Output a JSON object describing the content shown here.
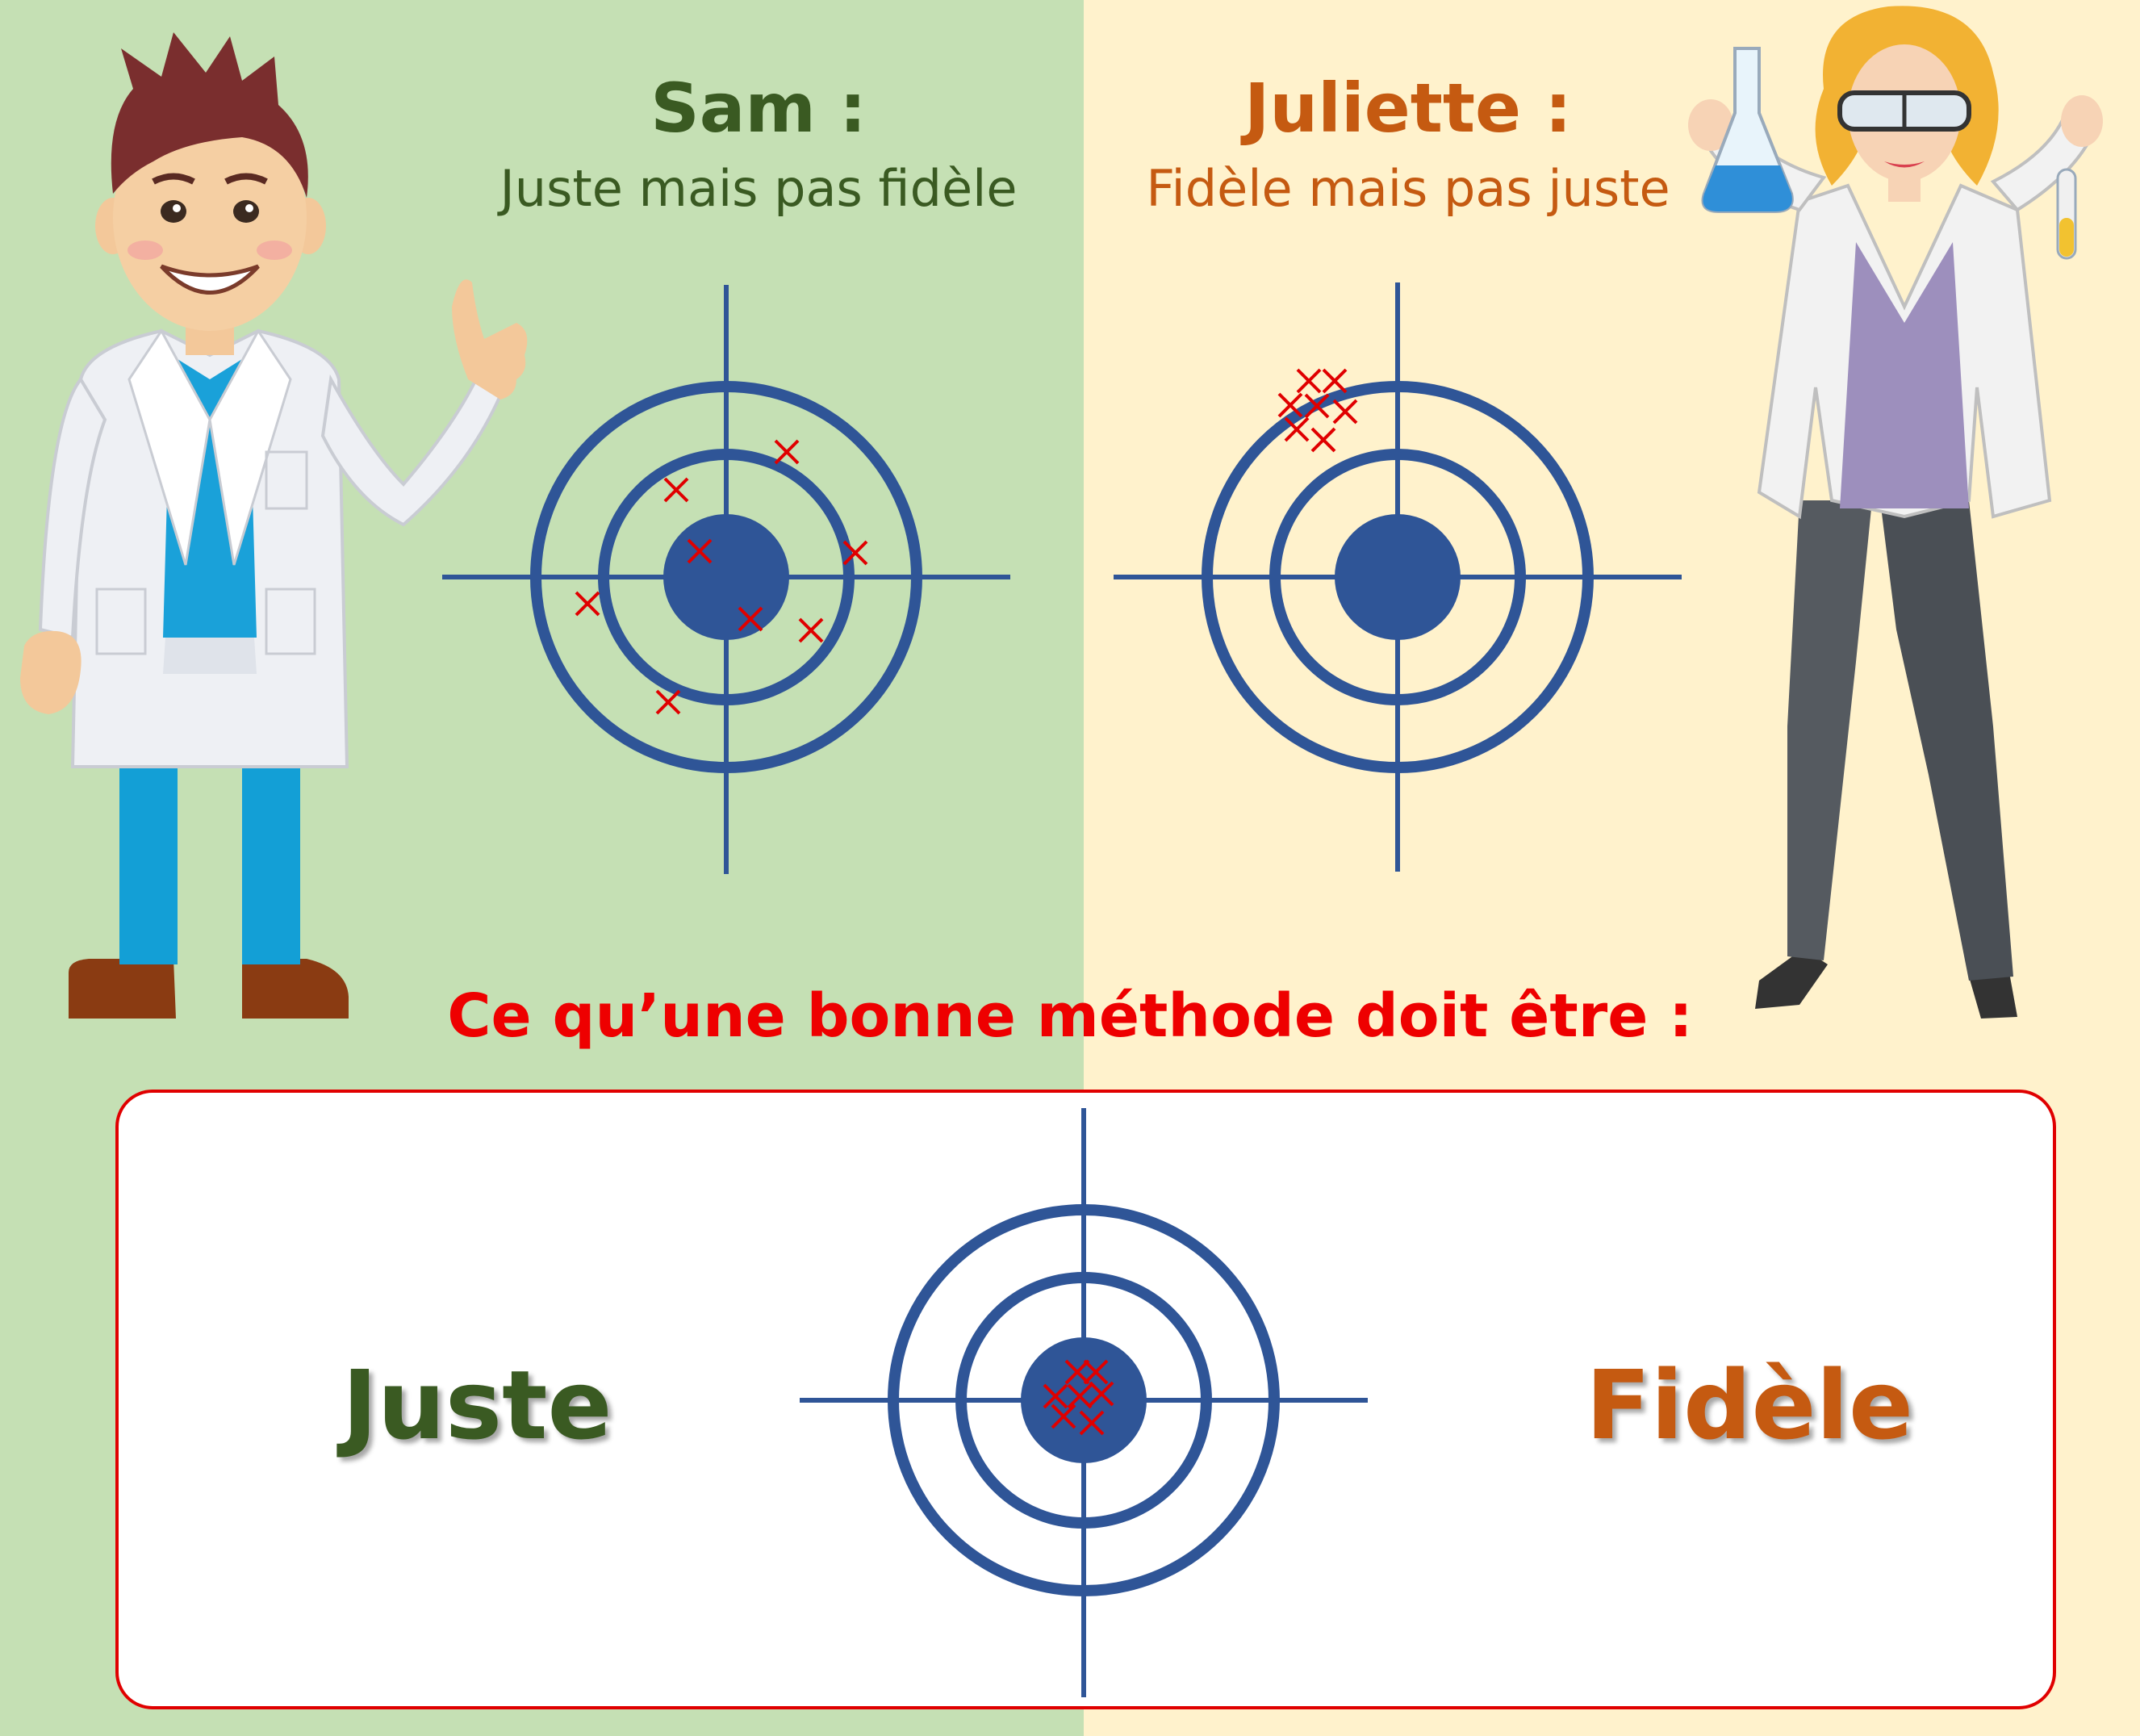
{
  "colors": {
    "left_bg": "#c5e0b4",
    "right_bg": "#fff2cc",
    "target": "#2f5597",
    "marks": "#e00000",
    "green_text": "#3a5a22",
    "orange_text": "#c55a11",
    "heading": "#ee0000",
    "box_border": "#e00000"
  },
  "sam": {
    "name": "Sam :",
    "description": "Juste mais pas fidèle",
    "illustration": "male-scientist-thumbs-up"
  },
  "juliette": {
    "name": "Juliette :",
    "description": "Fidèle mais pas juste",
    "illustration": "female-scientist-with-flasks"
  },
  "heading": "Ce qu’une bonne méthode doit être :",
  "good_method": {
    "left_label": "Juste",
    "right_label": "Fidèle"
  },
  "icons": {
    "target": "crosshair-target-icon",
    "mark": "cross-mark-icon"
  }
}
